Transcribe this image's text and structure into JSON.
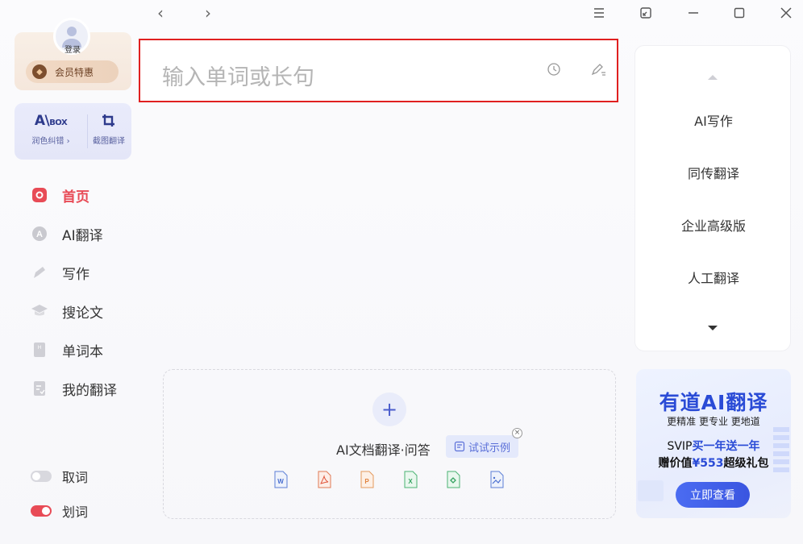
{
  "nav": {
    "back": "‹",
    "forward": "›"
  },
  "sidebar": {
    "login_label": "登录",
    "vip_label": "会员特惠",
    "aibox": {
      "logo_main": "A\\",
      "logo_small": "BOX",
      "left_caption": "润色纠错 ›",
      "right_caption": "截图翻译"
    },
    "menu": [
      {
        "label": "首页",
        "active": true,
        "icon": "home-icon"
      },
      {
        "label": "AI翻译",
        "active": false,
        "icon": "ai-translate-icon"
      },
      {
        "label": "写作",
        "active": false,
        "icon": "pen-icon"
      },
      {
        "label": "搜论文",
        "active": false,
        "icon": "graduation-cap-icon"
      },
      {
        "label": "单词本",
        "active": false,
        "icon": "notebook-icon"
      },
      {
        "label": "我的翻译",
        "active": false,
        "icon": "document-icon"
      }
    ],
    "toggles": [
      {
        "label": "取词",
        "on": false
      },
      {
        "label": "划词",
        "on": true
      }
    ]
  },
  "input": {
    "placeholder": "输入单词或长句"
  },
  "right_panel": {
    "items": [
      "AI写作",
      "同传翻译",
      "企业高级版",
      "人工翻译"
    ]
  },
  "promo": {
    "title": "有道AI翻译",
    "subtitle": "更精准 更专业 更地道",
    "line1_prefix": "SVIP",
    "line1_highlight": "买一年送一年",
    "line2_prefix": "赠价值",
    "line2_highlight": "¥553",
    "line2_suffix": "超级礼包",
    "button": "立即查看"
  },
  "doc_upload": {
    "title": "AI文档翻译·问答",
    "try_label": "试试示例",
    "file_types": [
      "W",
      "PDF",
      "P",
      "X",
      "E",
      "IMG"
    ]
  },
  "colors": {
    "accent_red": "#e84b56",
    "brand_blue": "#2a4bd6",
    "highlight_border": "#e02020"
  }
}
